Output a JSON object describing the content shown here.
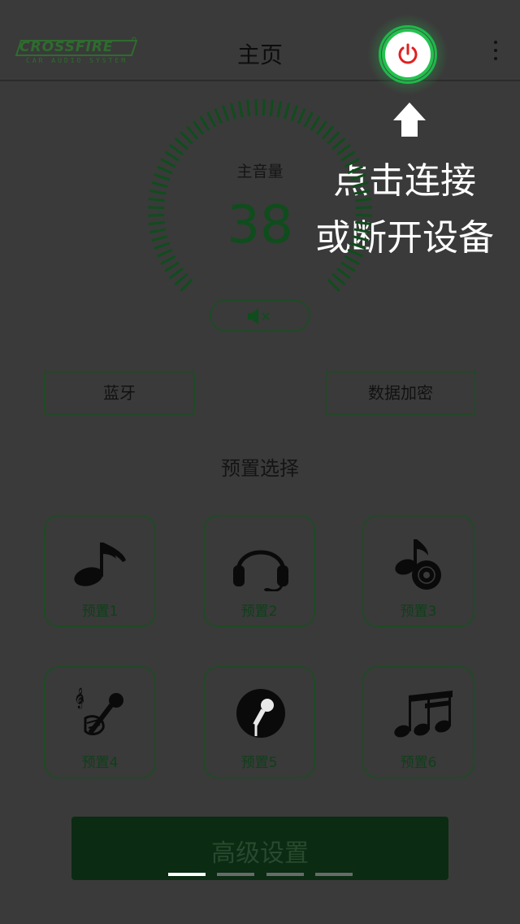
{
  "header": {
    "logo_main": "CROSSFIRE",
    "logo_sub": "CAR AUDIO SYSTEM",
    "title": "主页",
    "power_icon": "power-icon",
    "menu_icon": "more-vertical-icon"
  },
  "hint": {
    "line1": "点击连接",
    "line2": "或断开设备",
    "arrow_icon": "arrow-up-icon"
  },
  "volume": {
    "label": "主音量",
    "value": 38,
    "mute_icon": "speaker-muted-icon"
  },
  "buttons": {
    "bluetooth": "蓝牙",
    "encryption": "数据加密"
  },
  "presets": {
    "heading": "预置选择",
    "items": [
      {
        "label": "预置1",
        "icon": "music-note-icon"
      },
      {
        "label": "预置2",
        "icon": "headphones-icon"
      },
      {
        "label": "预置3",
        "icon": "music-disc-icon"
      },
      {
        "label": "预置4",
        "icon": "hand-microphone-icon"
      },
      {
        "label": "预置5",
        "icon": "microphone-circle-icon"
      },
      {
        "label": "预置6",
        "icon": "music-notes-icon"
      }
    ]
  },
  "advanced": {
    "label": "高级设置"
  },
  "pager": {
    "count": 4,
    "active": 0
  },
  "colors": {
    "background": "#3a3a3a",
    "accent_green": "#24c24f",
    "dark_green": "#0f4d1c",
    "power_red": "#e02020"
  }
}
